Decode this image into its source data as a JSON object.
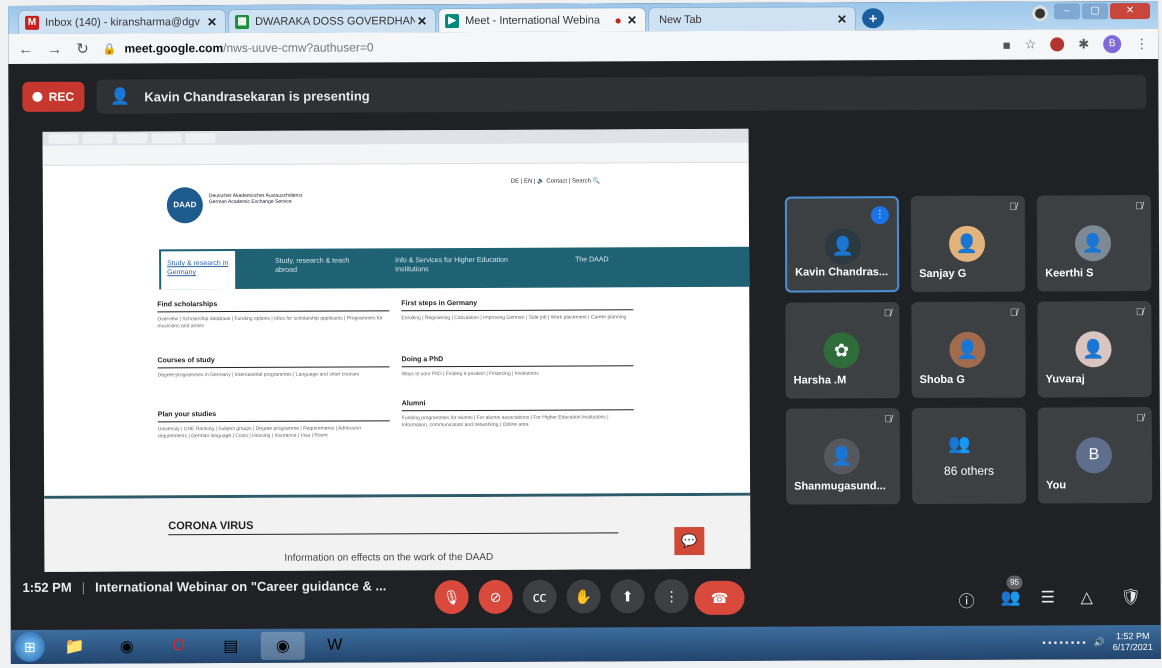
{
  "browser": {
    "tabs": [
      {
        "title": "Inbox (140) - kiransharma@dgv",
        "favicon": "gmail-icon",
        "color": "#c5221f",
        "active": false
      },
      {
        "title": "DWARAKA DOSS GOVERDHAN",
        "favicon": "classroom-icon",
        "color": "#1e8e3e",
        "active": false
      },
      {
        "title": "Meet - International Webina",
        "favicon": "meet-icon",
        "color": "#00897b",
        "active": true
      },
      {
        "title": "New Tab",
        "favicon": "",
        "color": "#cfe2f3",
        "active": false
      }
    ],
    "url_host": "meet.google.com",
    "url_path": "/nws-uuve-cmw?authuser=0",
    "account_initial": "B"
  },
  "meet": {
    "rec_label": "REC",
    "presenting_text": "Kavin Chandrasekaran is presenting",
    "time": "1:52 PM",
    "separator": "|",
    "meeting_title": "International Webinar on \"Career guidance & ...",
    "participant_count": "95",
    "participants": [
      {
        "name": "Kavin Chandras...",
        "speaking": true
      },
      {
        "name": "Sanjay G",
        "speaking": false
      },
      {
        "name": "Keerthi S",
        "speaking": false
      },
      {
        "name": "Harsha .M",
        "speaking": false
      },
      {
        "name": "Shoba G",
        "speaking": false
      },
      {
        "name": "Yuvaraj",
        "speaking": false
      },
      {
        "name": "Shanmugasund...",
        "speaking": false
      },
      {
        "name": "86 others",
        "speaking": false
      },
      {
        "name": "You",
        "speaking": false
      }
    ],
    "you_initial": "B"
  },
  "shared_screen": {
    "org_name": "Deutscher Akademischer Austauschdienst German Academic Exchange Service",
    "logo_text": "DAAD",
    "top_links": "DE | EN | 🔉    Contact | Search 🔍",
    "nav": [
      "Study & research in Germany",
      "Study, research & teach abroad",
      "Info & Services for Higher Education Institutions",
      "The DAAD"
    ],
    "sections": [
      {
        "title": "Find scholarships",
        "text": "Overview | Scholarship database | Funding options | Infos for scholarship applicants | Programmes for musicians and artists"
      },
      {
        "title": "Courses of study",
        "text": "Degree programmes in Germany | International programmes | Language and short courses"
      },
      {
        "title": "Plan your studies",
        "text": "University | CHE Ranking | Subject groups | Degree programme | Requirements | Admission requirements | German language | Costs | Housing | Insurance | Visa | Room"
      },
      {
        "title": "First steps in Germany",
        "text": "Enrolling | Registering | Calculation | Improving German | Side job | Work placement | Career planning"
      },
      {
        "title": "Doing a PhD",
        "text": "Ways to your PhD | Finding a position | Financing | Institutions"
      },
      {
        "title": "Alumni",
        "text": "Funding programmes for alumni | For alumni associations | For Higher Education Institutions | Information, communication and networking | Online area"
      }
    ],
    "corona_heading": "CORONA VIRUS",
    "info_text": "Information on effects on the work of the DAAD"
  },
  "taskbar": {
    "clock_time": "1:52 PM",
    "clock_date": "6/17/2021"
  }
}
